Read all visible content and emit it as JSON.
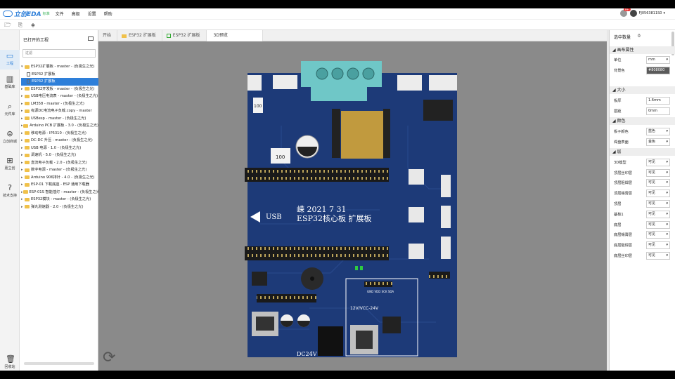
{
  "app": {
    "logo_text": "立创EDA",
    "edition": "标准",
    "menu": [
      "文件",
      "高级",
      "设置",
      "帮助"
    ],
    "notification_count": "9+",
    "username": "FJ0563811S0"
  },
  "left_nav": [
    {
      "label": "工程",
      "icon": "folder-icon"
    },
    {
      "label": "基础库",
      "icon": "library-icon"
    },
    {
      "label": "元件库",
      "icon": "component-icon"
    },
    {
      "label": "立创商城",
      "icon": "store-icon"
    },
    {
      "label": "嘉立创",
      "icon": "factory-icon"
    },
    {
      "label": "技术支持",
      "icon": "help-icon"
    },
    {
      "label": "回收站",
      "icon": "trash-icon"
    }
  ],
  "project_panel": {
    "title": "已打开的工程",
    "search_placeholder": "过滤",
    "tree": [
      {
        "label": "ESP32扩展板 - master - (负极生之光)",
        "type": "folder",
        "expanded": true
      },
      {
        "label": "ESP32 扩展板",
        "type": "doc",
        "child": true
      },
      {
        "label": "ESP32 扩展板",
        "type": "doc",
        "child": true,
        "selected": true
      },
      {
        "label": "ESP32开发板 - master - (负极生之光)",
        "type": "folder"
      },
      {
        "label": "USB电压电流表 - master - (负极生之光)",
        "type": "folder"
      },
      {
        "label": "LM358 - master - (负极生之光)",
        "type": "folder"
      },
      {
        "label": "有源DC电流电子负载.copy - master",
        "type": "folder"
      },
      {
        "label": "USBesp - master - (负极生之光)",
        "type": "folder"
      },
      {
        "label": "Arduino PCB 扩展板 - 3.0 - (负极生之光)",
        "type": "folder"
      },
      {
        "label": "移动电源 - IP5310 - (负极生之光)",
        "type": "folder"
      },
      {
        "label": "DC-DC 升压 - master - (负极生之光)",
        "type": "folder"
      },
      {
        "label": "USB 电源 - 1.0 - (负极生之光)",
        "type": "folder"
      },
      {
        "label": "调速机 - 5.0 - (负极生之光)",
        "type": "folder"
      },
      {
        "label": "直流电子负载 - 2.0 - (负极生之光)",
        "type": "folder"
      },
      {
        "label": "数字电源 - master - (负极生之光)",
        "type": "folder"
      },
      {
        "label": "Arduino 906排针 - 4.0 - (负极生之光)",
        "type": "folder"
      },
      {
        "label": "ESP-01 下载底座 - ESP 通用下载器",
        "type": "folder"
      },
      {
        "label": "ESP-01S 智能插灯 - master - (负极生之光)",
        "type": "folder"
      },
      {
        "label": "ESP32模块 - master - (负极生之光)",
        "type": "folder"
      },
      {
        "label": "弹丸测速器 - 2.0 - (负极生之光)",
        "type": "folder"
      }
    ]
  },
  "tabs": [
    {
      "label": "开始",
      "icon": "none"
    },
    {
      "label": "ESP32 扩展板",
      "icon": "folder"
    },
    {
      "label": "ESP32 扩展板",
      "icon": "pcb"
    },
    {
      "label": "3D预览",
      "icon": "none",
      "active": true
    }
  ],
  "pcb": {
    "silk_title": "嵘 2021 7 31",
    "silk_sub": "ESP32核心板 扩展板",
    "usb_label": "USB",
    "dc_label": "DC24V",
    "vin_label": "12V/VCC-24V",
    "i2c_labels": "GND VDD SCK SDA",
    "cap_label": "100",
    "res_label": "100",
    "board_color": "#1d3a78",
    "header_color": "#222222",
    "terminal_color": "#6fc7c7"
  },
  "right_panel": {
    "selected_label": "选中数量",
    "selected_count": "0",
    "sections": {
      "canvas": "画布属性",
      "size": "大小",
      "color": "颜色",
      "layer": "层"
    },
    "canvas_rows": [
      {
        "label": "单位",
        "value": "mm"
      },
      {
        "label": "背景色",
        "value": "#808080"
      }
    ],
    "size_rows": [
      {
        "label": "板厚",
        "value": "1.6mm"
      },
      {
        "label": "层距",
        "value": "0mm"
      }
    ],
    "color_rows": [
      {
        "label": "板子颜色",
        "value": "蓝色"
      },
      {
        "label": "焊盘表面",
        "value": "金色"
      }
    ],
    "layer_rows": [
      {
        "label": "3D模型",
        "value": "可见"
      },
      {
        "label": "顶层丝印层",
        "value": "可见"
      },
      {
        "label": "顶层阻焊层",
        "value": "可见"
      },
      {
        "label": "顶层锡膏层",
        "value": "可见"
      },
      {
        "label": "顶层",
        "value": "可见"
      },
      {
        "label": "基板1",
        "value": "可见"
      },
      {
        "label": "底层",
        "value": "可见"
      },
      {
        "label": "底层锡膏层",
        "value": "可见"
      },
      {
        "label": "底层阻焊层",
        "value": "可见"
      },
      {
        "label": "底层丝印层",
        "value": "可见"
      }
    ]
  }
}
